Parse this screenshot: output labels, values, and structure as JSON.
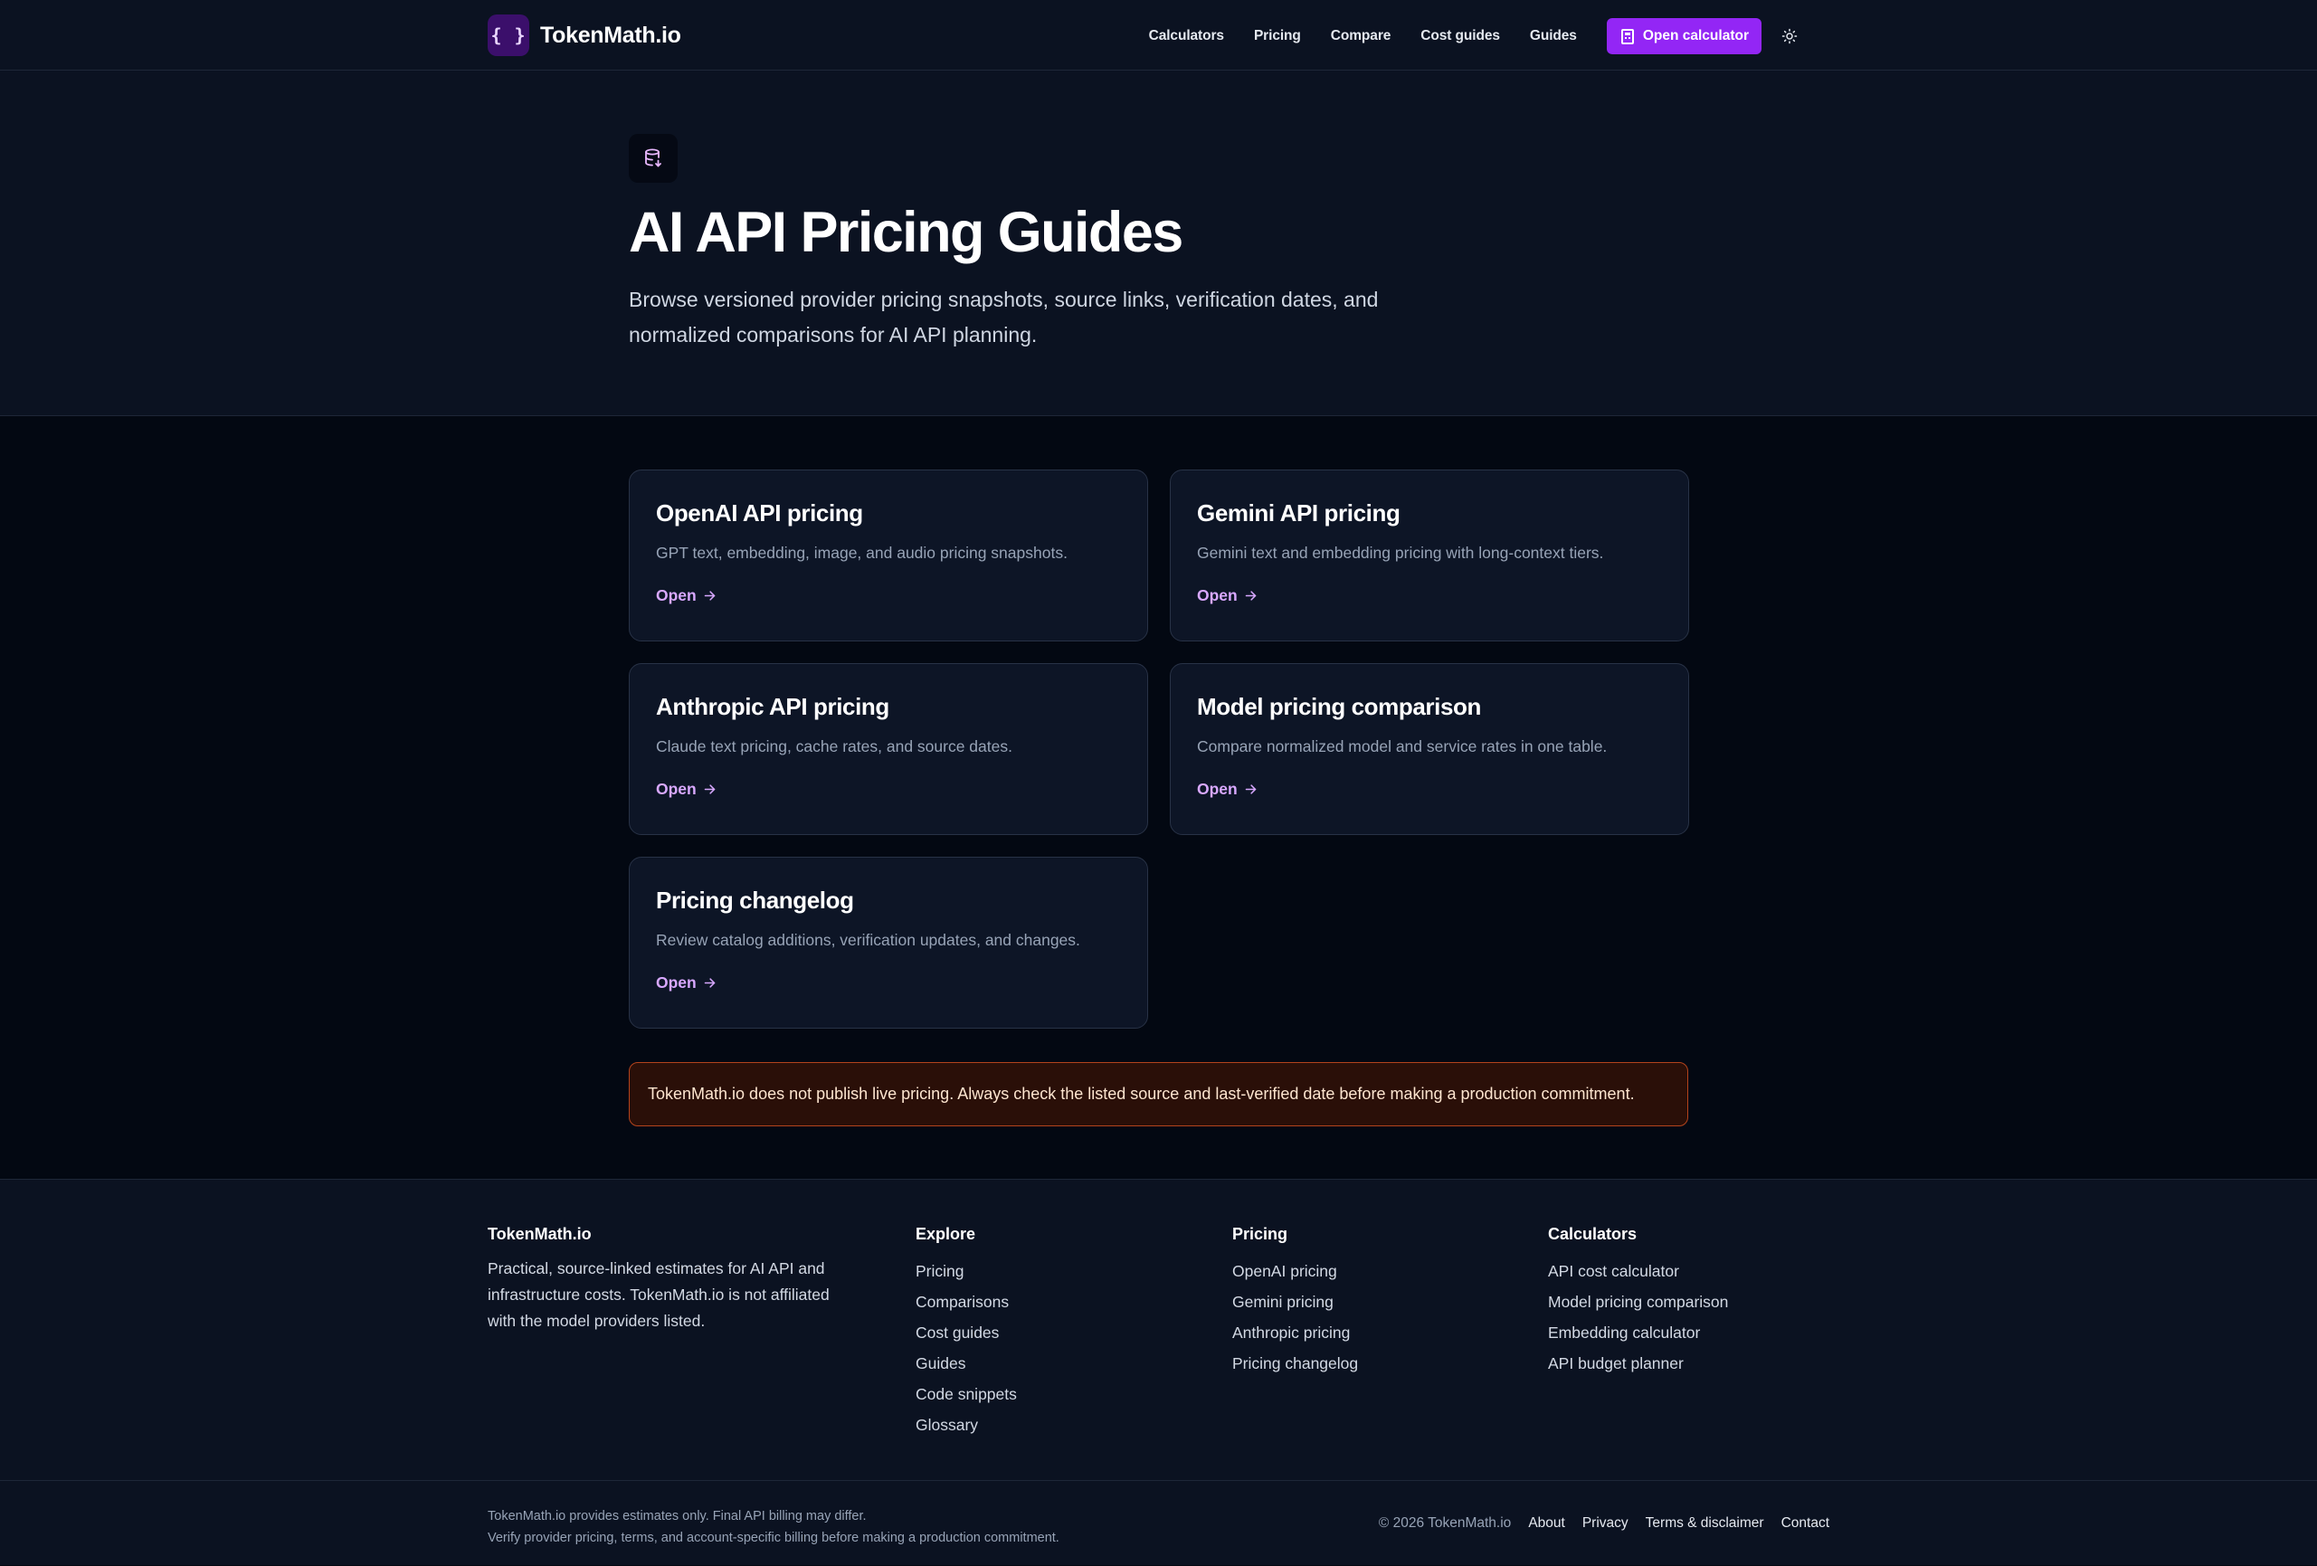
{
  "header": {
    "brand_mark": "{ }",
    "brand_name": "TokenMath.io",
    "nav": [
      "Calculators",
      "Pricing",
      "Compare",
      "Cost guides",
      "Guides"
    ],
    "cta_label": "Open calculator",
    "cta_icon": "calculator-icon",
    "theme_icon": "sun-icon"
  },
  "hero": {
    "icon": "database-icon",
    "title": "AI API Pricing Guides",
    "description": "Browse versioned provider pricing snapshots, source links, verification dates, and normalized comparisons for AI API planning."
  },
  "cards": [
    {
      "title": "OpenAI API pricing",
      "description": "GPT text, embedding, image, and audio pricing snapshots.",
      "link": "Open"
    },
    {
      "title": "Gemini API pricing",
      "description": "Gemini text and embedding pricing with long-context tiers.",
      "link": "Open"
    },
    {
      "title": "Anthropic API pricing",
      "description": "Claude text pricing, cache rates, and source dates.",
      "link": "Open"
    },
    {
      "title": "Model pricing comparison",
      "description": "Compare normalized model and service rates in one table.",
      "link": "Open"
    },
    {
      "title": "Pricing changelog",
      "description": "Review catalog additions, verification updates, and changes.",
      "link": "Open"
    }
  ],
  "notice": "TokenMath.io does not publish live pricing. Always check the listed source and last-verified date before making a production commitment.",
  "footer": {
    "about_title": "TokenMath.io",
    "about_text": "Practical, source-linked estimates for AI API and infrastructure costs. TokenMath.io is not affiliated with the model providers listed.",
    "explore": {
      "title": "Explore",
      "links": [
        "Pricing",
        "Comparisons",
        "Cost guides",
        "Guides",
        "Code snippets",
        "Glossary"
      ]
    },
    "pricing": {
      "title": "Pricing",
      "links": [
        "OpenAI pricing",
        "Gemini pricing",
        "Anthropic pricing",
        "Pricing changelog"
      ]
    },
    "calculators": {
      "title": "Calculators",
      "links": [
        "API cost calculator",
        "Model pricing comparison",
        "Embedding calculator",
        "API budget planner"
      ]
    },
    "legal_line1": "TokenMath.io provides estimates only. Final API billing may differ.",
    "legal_line2": "Verify provider pricing, terms, and account-specific billing before making a production commitment.",
    "copyright": "© 2026 TokenMath.io",
    "bottom_links": [
      "About",
      "Privacy",
      "Terms & disclaimer",
      "Contact"
    ]
  },
  "colors": {
    "accent": "#9326f5",
    "link": "#d8a8ff",
    "page_bg": "#030812",
    "surface": "#0b1221",
    "notice_border": "#b4431c"
  }
}
